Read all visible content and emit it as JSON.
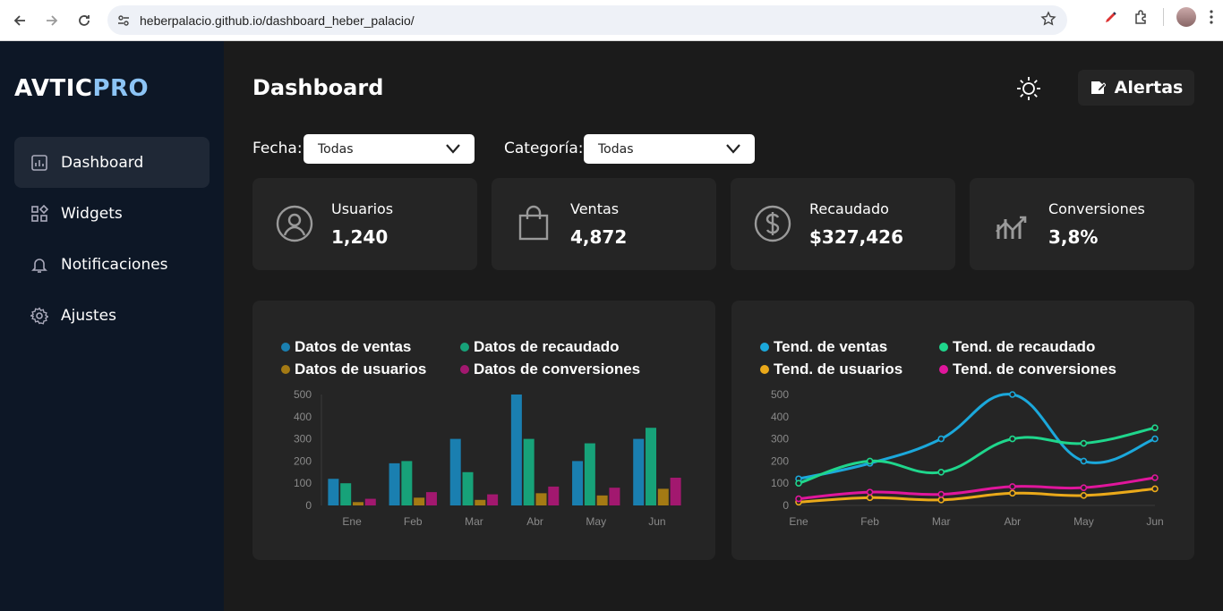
{
  "browser": {
    "url": "heberpalacio.github.io/dashboard_heber_palacio/"
  },
  "sidebar": {
    "logo_main": "AVTIC",
    "logo_accent": "PRO",
    "items": [
      {
        "label": "Dashboard",
        "icon": "chart-icon",
        "active": true
      },
      {
        "label": "Widgets",
        "icon": "widgets-icon",
        "active": false
      },
      {
        "label": "Notificaciones",
        "icon": "bell-icon",
        "active": false
      },
      {
        "label": "Ajustes",
        "icon": "gear-icon",
        "active": false
      }
    ]
  },
  "header": {
    "title": "Dashboard",
    "alert_label": "Alertas"
  },
  "filters": {
    "fecha_label": "Fecha:",
    "fecha_value": "Todas",
    "categoria_label": "Categoría:",
    "categoria_value": "Todas"
  },
  "cards": [
    {
      "label": "Usuarios",
      "value": "1,240",
      "icon": "user-icon"
    },
    {
      "label": "Ventas",
      "value": "4,872",
      "icon": "bag-icon"
    },
    {
      "label": "Recaudado",
      "value": "$327,426",
      "icon": "dollar-icon"
    },
    {
      "label": "Conversiones",
      "value": "3,8%",
      "icon": "trend-icon"
    }
  ],
  "chart_data": [
    {
      "type": "bar",
      "categories": [
        "Ene",
        "Feb",
        "Mar",
        "Abr",
        "May",
        "Jun"
      ],
      "ylim": [
        0,
        500
      ],
      "yticks": [
        0,
        100,
        200,
        300,
        400,
        500
      ],
      "grid": false,
      "legend_position": "top",
      "series": [
        {
          "name": "Datos de ventas",
          "color": "#1a7fb0",
          "values": [
            120,
            190,
            300,
            500,
            200,
            300
          ]
        },
        {
          "name": "Datos de recaudado",
          "color": "#17a279",
          "values": [
            100,
            200,
            150,
            300,
            280,
            350
          ]
        },
        {
          "name": "Datos de usuarios",
          "color": "#a47a14",
          "values": [
            15,
            35,
            25,
            55,
            45,
            75
          ]
        },
        {
          "name": "Datos de conversiones",
          "color": "#a2186f",
          "values": [
            30,
            60,
            50,
            85,
            80,
            125
          ]
        }
      ]
    },
    {
      "type": "line",
      "categories": [
        "Ene",
        "Feb",
        "Mar",
        "Abr",
        "May",
        "Jun"
      ],
      "ylim": [
        0,
        500
      ],
      "yticks": [
        0,
        100,
        200,
        300,
        400,
        500
      ],
      "grid": false,
      "legend_position": "top",
      "series": [
        {
          "name": "Tend. de ventas",
          "color": "#1ba8db",
          "values": [
            120,
            190,
            300,
            500,
            200,
            300
          ]
        },
        {
          "name": "Tend. de recaudado",
          "color": "#1fd68c",
          "values": [
            100,
            200,
            150,
            300,
            280,
            350
          ]
        },
        {
          "name": "Tend. de usuarios",
          "color": "#eaa91a",
          "values": [
            15,
            35,
            25,
            55,
            45,
            75
          ]
        },
        {
          "name": "Tend. de conversiones",
          "color": "#e0169c",
          "values": [
            30,
            60,
            50,
            85,
            80,
            125
          ]
        }
      ]
    }
  ]
}
